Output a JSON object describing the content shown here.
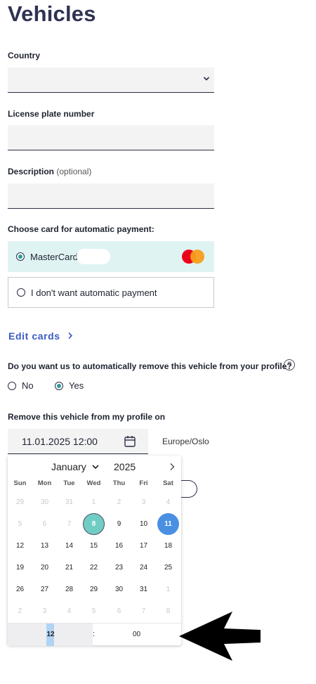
{
  "page": {
    "title": "Vehicles"
  },
  "country": {
    "label": "Country",
    "value": ""
  },
  "license_plate": {
    "label": "License plate number",
    "value": ""
  },
  "description": {
    "label": "Description",
    "optional": "(optional)",
    "value": ""
  },
  "payment": {
    "label": "Choose card for automatic payment:",
    "options": [
      {
        "label": "MasterCard",
        "selected": true,
        "icon": "mastercard-logo"
      },
      {
        "label": "I don't want automatic payment",
        "selected": false
      }
    ]
  },
  "edit_cards": {
    "label": "Edit cards",
    "icon": "chevron-right-icon",
    "color": "#3b5bc3"
  },
  "auto_remove": {
    "question": "Do you want us to automatically remove this vehicle from your profile?",
    "help_icon": "?",
    "options": [
      {
        "label": "No",
        "selected": false
      },
      {
        "label": "Yes",
        "selected": true
      }
    ]
  },
  "remove_date": {
    "label": "Remove this vehicle from my profile on",
    "value": "11.01.2025 12:00",
    "timezone": "Europe/Oslo"
  },
  "calendar": {
    "month": "January",
    "year": "2025",
    "weekdays": [
      "Sun",
      "Mon",
      "Tue",
      "Wed",
      "Thu",
      "Fri",
      "Sat"
    ],
    "weeks": [
      [
        {
          "d": "29",
          "m": true
        },
        {
          "d": "30",
          "m": true
        },
        {
          "d": "31",
          "m": true
        },
        {
          "d": "1",
          "m": true
        },
        {
          "d": "2",
          "m": true
        },
        {
          "d": "3",
          "m": true
        },
        {
          "d": "4",
          "m": true
        }
      ],
      [
        {
          "d": "5",
          "m": true
        },
        {
          "d": "6",
          "m": true
        },
        {
          "d": "7",
          "m": true
        },
        {
          "d": "8",
          "today": true
        },
        {
          "d": "9"
        },
        {
          "d": "10"
        },
        {
          "d": "11",
          "selected": true
        }
      ],
      [
        {
          "d": "12"
        },
        {
          "d": "13"
        },
        {
          "d": "14"
        },
        {
          "d": "15"
        },
        {
          "d": "16"
        },
        {
          "d": "17"
        },
        {
          "d": "18"
        }
      ],
      [
        {
          "d": "19"
        },
        {
          "d": "20"
        },
        {
          "d": "21"
        },
        {
          "d": "22"
        },
        {
          "d": "23"
        },
        {
          "d": "24"
        },
        {
          "d": "25"
        }
      ],
      [
        {
          "d": "26"
        },
        {
          "d": "27"
        },
        {
          "d": "28"
        },
        {
          "d": "29"
        },
        {
          "d": "30"
        },
        {
          "d": "31"
        },
        {
          "d": "1",
          "m": true
        }
      ],
      [
        {
          "d": "2",
          "m": true
        },
        {
          "d": "3",
          "m": true
        },
        {
          "d": "4",
          "m": true
        },
        {
          "d": "5",
          "m": true
        },
        {
          "d": "6",
          "m": true
        },
        {
          "d": "7",
          "m": true
        },
        {
          "d": "8",
          "m": true
        }
      ]
    ],
    "time": {
      "hour": "12",
      "separator": ":",
      "minute": "00"
    },
    "colors": {
      "today": "#6fcdc4",
      "selected": "#4a90e2"
    }
  }
}
